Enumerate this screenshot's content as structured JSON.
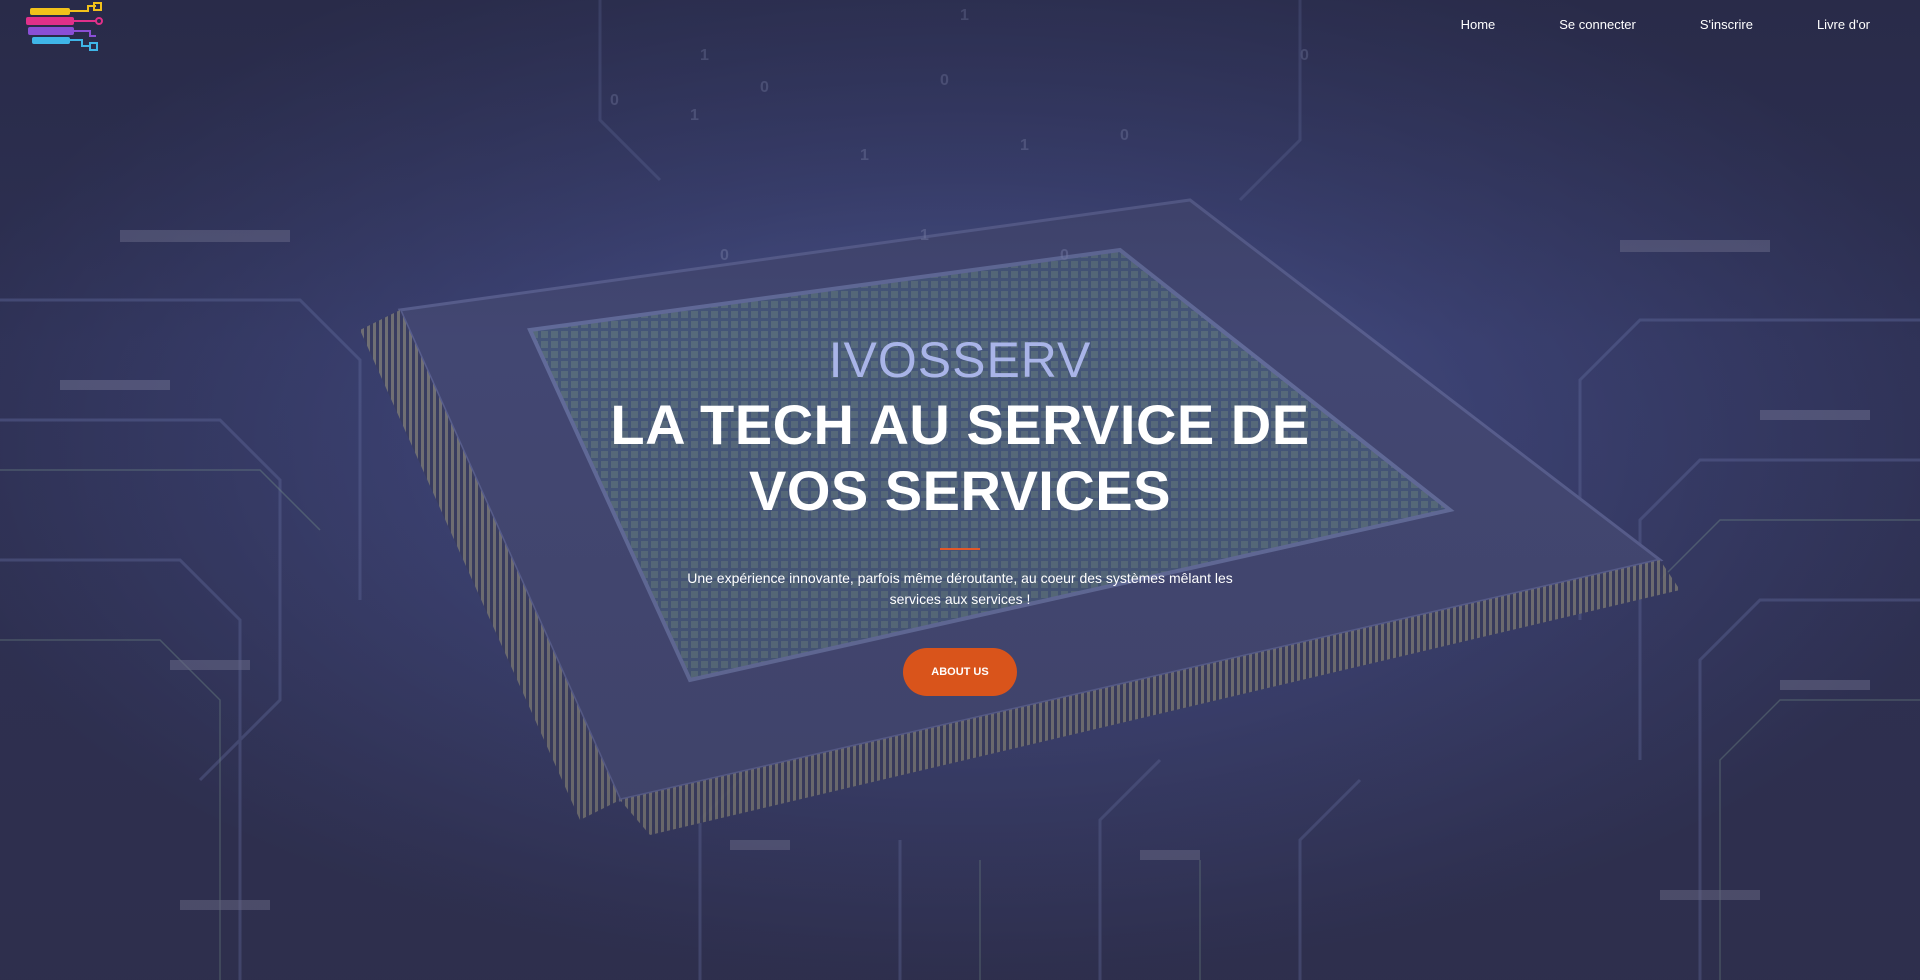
{
  "nav": {
    "items": [
      {
        "label": "Home"
      },
      {
        "label": "Se connecter"
      },
      {
        "label": "S'inscrire"
      },
      {
        "label": "Livre d'or"
      }
    ]
  },
  "logo": {
    "icon": "circuit-brain-logo-icon",
    "colors": [
      "#f2c21b",
      "#e0308a",
      "#8a4fd6",
      "#3fb6e8"
    ]
  },
  "hero": {
    "brand": "IVOSSERV",
    "headline_line1": "LA TECH AU SERVICE DE",
    "headline_line2": "VOS SERVICES",
    "description": "Une expérience innovante, parfois même déroutante, au coeur des systèmes mêlant les services aux services !",
    "cta_label": "ABOUT US",
    "background": "circuit-board-chip-background"
  },
  "colors": {
    "accent": "#d9541b",
    "brand_text": "#a9b4e8",
    "background": "#2e3258"
  }
}
